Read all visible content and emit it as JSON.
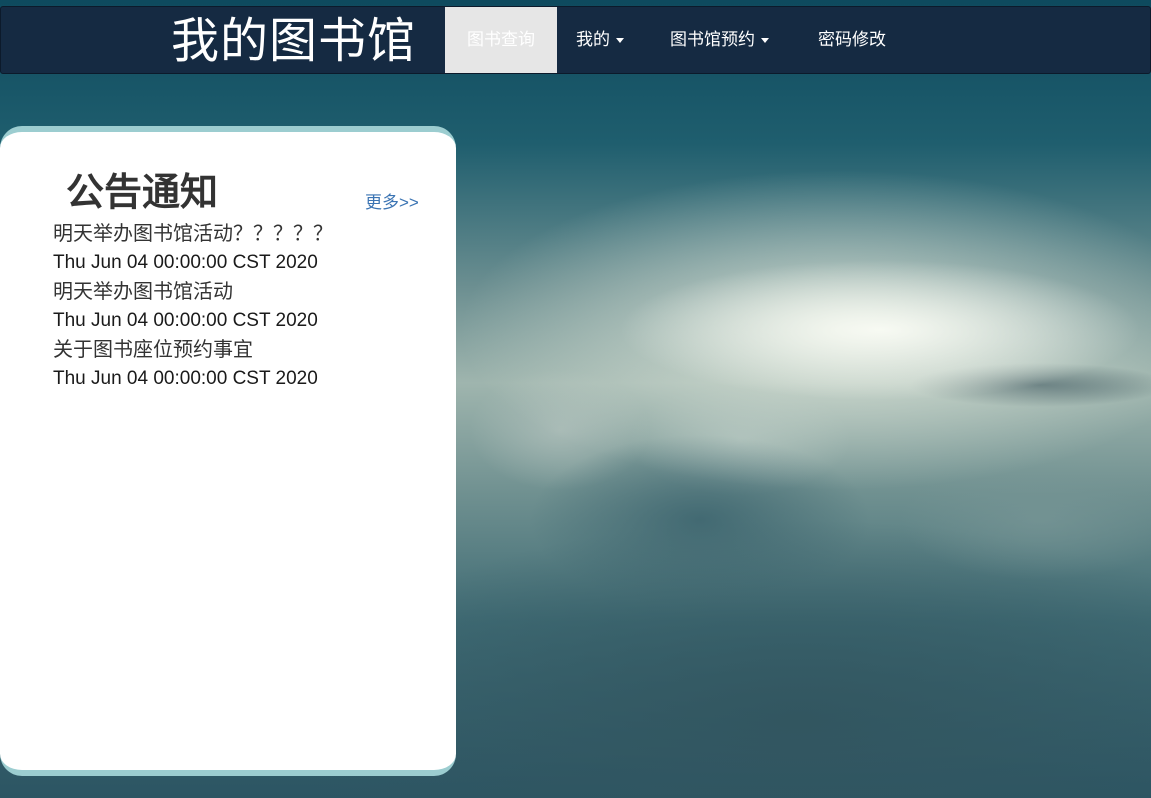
{
  "navbar": {
    "brand": "我的图书馆",
    "items": [
      {
        "label": "图书查询",
        "active": true,
        "dropdown": false
      },
      {
        "label": "我的",
        "active": false,
        "dropdown": true
      },
      {
        "label": "图书馆预约",
        "active": false,
        "dropdown": true
      },
      {
        "label": "密码修改",
        "active": false,
        "dropdown": false
      }
    ]
  },
  "notice": {
    "title": "公告通知",
    "more_label": "更多>>",
    "items": [
      {
        "text": "明天举办图书馆活动？？？？？",
        "date": "Thu Jun 04 00:00:00 CST 2020"
      },
      {
        "text": "明天举办图书馆活动",
        "date": "Thu Jun 04 00:00:00 CST 2020"
      },
      {
        "text": "关于图书座位预约事宜",
        "date": "Thu Jun 04 00:00:00 CST 2020"
      }
    ]
  },
  "colors": {
    "navbar_bg": "#152a42",
    "panel_accent": "#9ccdd0",
    "link": "#3b74b3"
  }
}
